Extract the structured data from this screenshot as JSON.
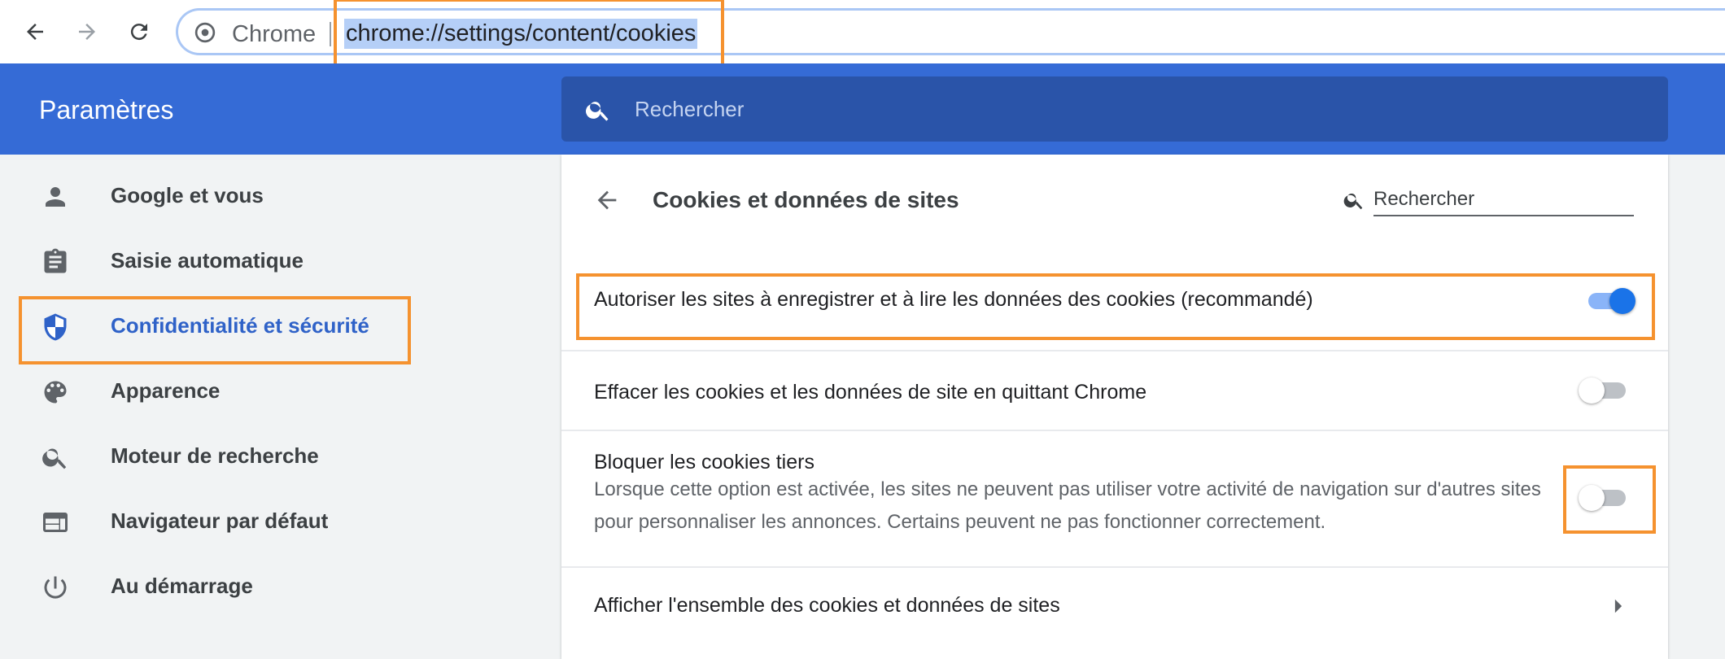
{
  "browser": {
    "back_icon": "arrow-left-icon",
    "forward_icon": "arrow-right-icon",
    "reload_icon": "reload-icon",
    "chrome_label": "Chrome",
    "url": "chrome://settings/content/cookies"
  },
  "header": {
    "title": "Paramètres",
    "search_placeholder": "Rechercher"
  },
  "sidebar": {
    "items": [
      {
        "label": "Google et vous",
        "icon": "person-icon"
      },
      {
        "label": "Saisie automatique",
        "icon": "clipboard-icon"
      },
      {
        "label": "Confidentialité et sécurité",
        "icon": "shield-icon",
        "active": true
      },
      {
        "label": "Apparence",
        "icon": "palette-icon"
      },
      {
        "label": "Moteur de recherche",
        "icon": "search-icon"
      },
      {
        "label": "Navigateur par défaut",
        "icon": "browser-window-icon"
      },
      {
        "label": "Au démarrage",
        "icon": "power-icon"
      }
    ]
  },
  "page": {
    "title": "Cookies et données de sites",
    "search_placeholder": "Rechercher",
    "settings": [
      {
        "label": "Autoriser les sites à enregistrer et à lire les données des cookies (recommandé)",
        "enabled": true
      },
      {
        "label": "Effacer les cookies et les données de site en quittant Chrome",
        "enabled": false
      },
      {
        "label": "Bloquer les cookies tiers",
        "description": "Lorsque cette option est activée, les sites ne peuvent pas utiliser votre activité de navigation sur d'autres sites pour personnaliser les annonces. Certains peuvent ne pas fonctionner correctement.",
        "enabled": false
      },
      {
        "label": "Afficher l'ensemble des cookies et données de sites"
      }
    ]
  },
  "colors": {
    "header_bg": "#356bd6",
    "accent": "#1a73e8",
    "highlight": "#f5922f"
  }
}
